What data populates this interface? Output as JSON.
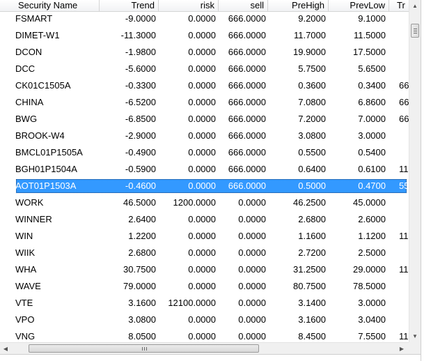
{
  "columns": [
    "Security Name",
    "Trend",
    "risk",
    "sell",
    "PreHigh",
    "PrevLow",
    "Tr"
  ],
  "rows": [
    [
      "FSMART",
      "-9.0000",
      "0.0000",
      "666.0000",
      "9.2000",
      "9.1000",
      ""
    ],
    [
      "DIMET-W1",
      "-11.3000",
      "0.0000",
      "666.0000",
      "11.7000",
      "11.5000",
      ""
    ],
    [
      "DCON",
      "-1.9800",
      "0.0000",
      "666.0000",
      "19.9000",
      "17.5000",
      ""
    ],
    [
      "DCC",
      "-5.6000",
      "0.0000",
      "666.0000",
      "5.7500",
      "5.6500",
      ""
    ],
    [
      "CK01C1505A",
      "-0.3300",
      "0.0000",
      "666.0000",
      "0.3600",
      "0.3400",
      "66"
    ],
    [
      "CHINA",
      "-6.5200",
      "0.0000",
      "666.0000",
      "7.0800",
      "6.8600",
      "66"
    ],
    [
      "BWG",
      "-6.8500",
      "0.0000",
      "666.0000",
      "7.2000",
      "7.0000",
      "66"
    ],
    [
      "BROOK-W4",
      "-2.9000",
      "0.0000",
      "666.0000",
      "3.0800",
      "3.0000",
      ""
    ],
    [
      "BMCL01P1505A",
      "-0.4900",
      "0.0000",
      "666.0000",
      "0.5500",
      "0.5400",
      ""
    ],
    [
      "BGH01P1504A",
      "-0.5900",
      "0.0000",
      "666.0000",
      "0.6400",
      "0.6100",
      "11"
    ],
    [
      "AOT01P1503A",
      "-0.4600",
      "0.0000",
      "666.0000",
      "0.5000",
      "0.4700",
      "55"
    ],
    [
      "WORK",
      "46.5000",
      "1200.0000",
      "0.0000",
      "46.2500",
      "45.0000",
      ""
    ],
    [
      "WINNER",
      "2.6400",
      "0.0000",
      "0.0000",
      "2.6800",
      "2.6000",
      ""
    ],
    [
      "WIN",
      "1.2200",
      "0.0000",
      "0.0000",
      "1.1600",
      "1.1200",
      "11"
    ],
    [
      "WIIK",
      "2.6800",
      "0.0000",
      "0.0000",
      "2.7200",
      "2.5000",
      ""
    ],
    [
      "WHA",
      "30.7500",
      "0.0000",
      "0.0000",
      "31.2500",
      "29.0000",
      "11"
    ],
    [
      "WAVE",
      "79.0000",
      "0.0000",
      "0.0000",
      "80.7500",
      "78.5000",
      ""
    ],
    [
      "VTE",
      "3.1600",
      "12100.0000",
      "0.0000",
      "3.1400",
      "3.0000",
      ""
    ],
    [
      "VPO",
      "3.0800",
      "0.0000",
      "0.0000",
      "3.1600",
      "3.0400",
      ""
    ],
    [
      "VNG",
      "8.0500",
      "0.0000",
      "0.0000",
      "8.4500",
      "7.5500",
      "11"
    ]
  ],
  "selected_row": 10,
  "scrollbar": {
    "up_glyph": "▲",
    "down_glyph": "▼",
    "left_glyph": "◀",
    "right_glyph": "▶",
    "vertical_position": 0.05,
    "horizontal_position": 0.07
  },
  "colors": {
    "selection": "#3399ff",
    "selection_text": "#ffffff"
  }
}
